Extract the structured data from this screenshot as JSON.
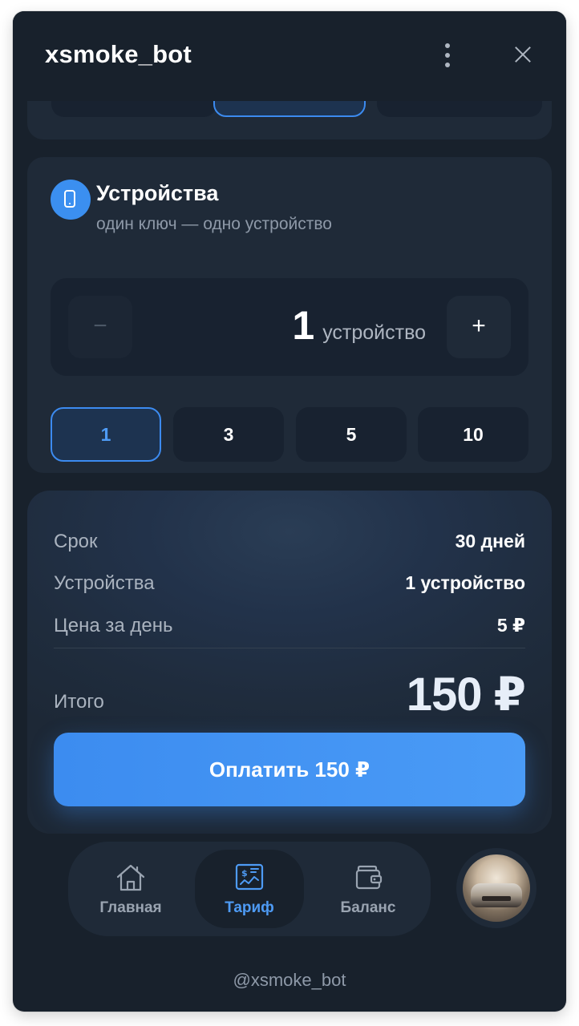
{
  "window": {
    "title": "xsmoke_bot",
    "menu_icon": "more-vertical-icon",
    "close_icon": "close-icon"
  },
  "devices": {
    "title": "Устройства",
    "subtitle": "один ключ — одно устройство",
    "icon": "smartphone-icon",
    "stepper": {
      "minus_label": "−",
      "plus_label": "+",
      "count": "1",
      "unit": "устройство"
    },
    "presets": [
      {
        "label": "1",
        "selected": true
      },
      {
        "label": "3",
        "selected": false
      },
      {
        "label": "5",
        "selected": false
      },
      {
        "label": "10",
        "selected": false
      }
    ]
  },
  "summary": {
    "rows": [
      {
        "label": "Срок",
        "value": "30 дней"
      },
      {
        "label": "Устройства",
        "value": "1 устройство"
      },
      {
        "label": "Цена за день",
        "value": "5 ₽"
      }
    ],
    "total_label": "Итого",
    "total_value": "150 ₽",
    "pay_button": "Оплатить 150 ₽"
  },
  "nav": {
    "items": [
      {
        "label": "Главная",
        "icon": "home-icon",
        "active": false
      },
      {
        "label": "Тариф",
        "icon": "tariff-receipt-icon",
        "active": true
      },
      {
        "label": "Баланс",
        "icon": "wallet-icon",
        "active": false
      }
    ]
  },
  "footer": {
    "handle": "@xsmoke_bot"
  },
  "colors": {
    "background": "#18212c",
    "card": "#1f2a38",
    "accent": "#3c8cf0",
    "accent_text": "#4e9bf5"
  }
}
